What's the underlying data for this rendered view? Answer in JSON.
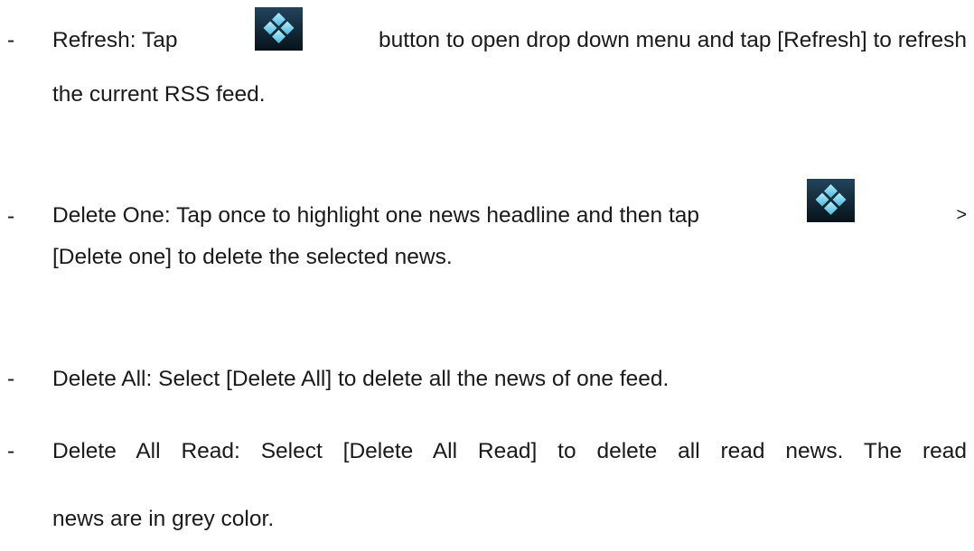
{
  "bullet_char": "-",
  "items": [
    {
      "line1": {
        "before_icon": "Refresh: Tap",
        "after_icon": "button to open drop down menu and tap [Refresh] to refresh"
      },
      "line2": "the current RSS feed.",
      "icon": "menu-diamond-icon"
    },
    {
      "line1": {
        "before_icon": "Delete One: Tap once to highlight one news headline and then tap",
        "after_icon": ">"
      },
      "line2": "[Delete one] to delete the selected news.",
      "icon": "menu-diamond-icon"
    },
    {
      "line1": "Delete All: Select [Delete All] to delete all the news of one feed."
    },
    {
      "line1": "Delete All Read: Select [Delete All Read] to delete all read news. The read",
      "line2": "news are in grey color."
    }
  ],
  "colors": {
    "text": "#1a1a1a",
    "icon_bg_top": "#1b3a52",
    "icon_bg_bottom": "#0a1620",
    "icon_diamond": "#7fd6f0"
  }
}
